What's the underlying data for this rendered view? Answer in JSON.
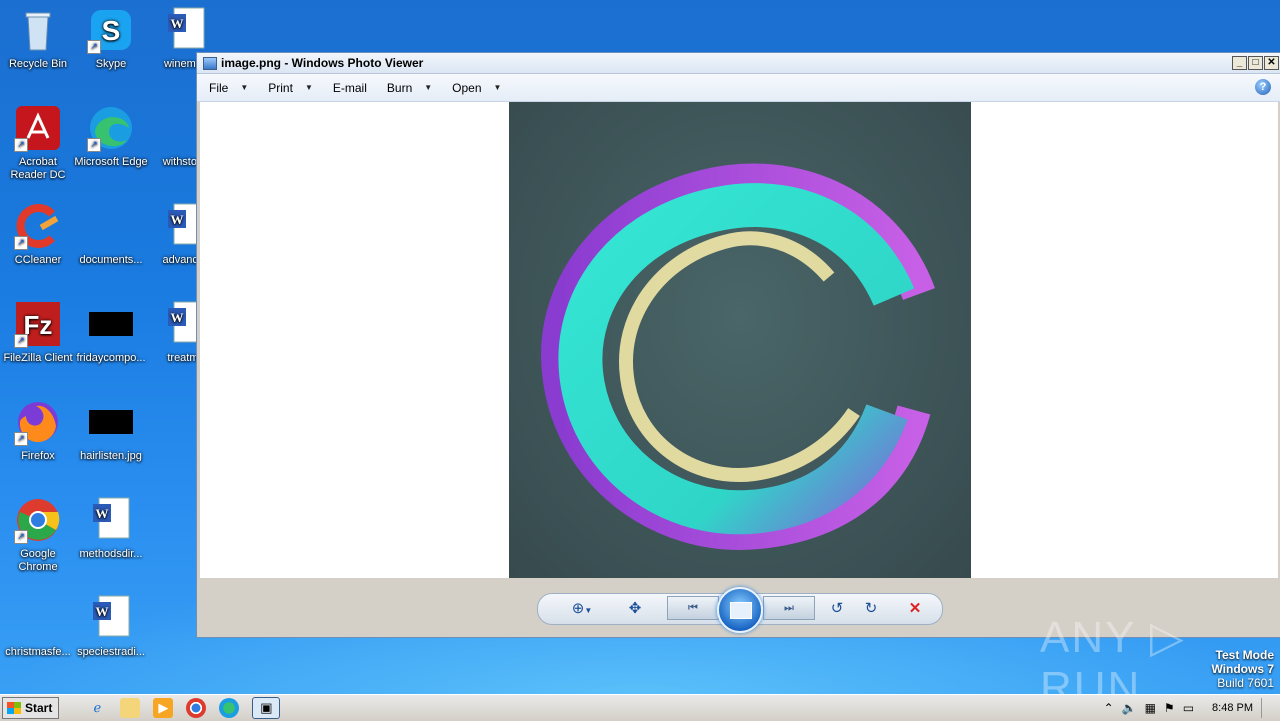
{
  "desktop": {
    "icons": [
      {
        "label": "Recycle Bin",
        "icon": "recycle-bin-icon"
      },
      {
        "label": "Skype",
        "icon": "skype-icon"
      },
      {
        "label": "winemag",
        "icon": "word-doc-icon"
      },
      {
        "label": "Acrobat Reader DC",
        "icon": "acrobat-icon"
      },
      {
        "label": "Microsoft Edge",
        "icon": "edge-icon"
      },
      {
        "label": "withstone",
        "icon": "blank-file-icon"
      },
      {
        "label": "CCleaner",
        "icon": "ccleaner-icon"
      },
      {
        "label": "documents...",
        "icon": "blank-file-icon"
      },
      {
        "label": "advances",
        "icon": "word-doc-icon"
      },
      {
        "label": "FileZilla Client",
        "icon": "filezilla-icon"
      },
      {
        "label": "fridaycompo...",
        "icon": "black-image-icon"
      },
      {
        "label": "treatme",
        "icon": "word-doc-icon"
      },
      {
        "label": "Firefox",
        "icon": "firefox-icon"
      },
      {
        "label": "hairlisten.jpg",
        "icon": "black-image-icon"
      },
      {
        "label": "Google Chrome",
        "icon": "chrome-icon"
      },
      {
        "label": "methodsdir...",
        "icon": "word-doc-icon"
      },
      {
        "label": "christmasfe...",
        "icon": "blank-file-icon"
      },
      {
        "label": "speciestradi...",
        "icon": "word-doc-icon"
      }
    ]
  },
  "window": {
    "title": "image.png - Windows Photo Viewer",
    "menu": [
      {
        "label": "File"
      },
      {
        "label": "Print"
      },
      {
        "label": "E-mail"
      },
      {
        "label": "Burn"
      },
      {
        "label": "Open"
      }
    ],
    "help": "?"
  },
  "controls": {
    "zoom": "⊕",
    "fit": "✥",
    "prev": "⏮",
    "next": "⏭",
    "rotate_left": "↺",
    "rotate_right": "↻",
    "delete": "✕"
  },
  "overlay": {
    "watermark": "ANY ▷ RUN",
    "test_mode": "Test Mode",
    "os": "Windows 7",
    "build": "Build 7601"
  },
  "taskbar": {
    "start": "Start",
    "clock": "8:48 PM"
  },
  "colors": {
    "accent": "#1c68c6",
    "logo_cyan": "#35e6d4",
    "logo_purple": "#a64bdc",
    "logo_cream": "#f2e8a8"
  }
}
